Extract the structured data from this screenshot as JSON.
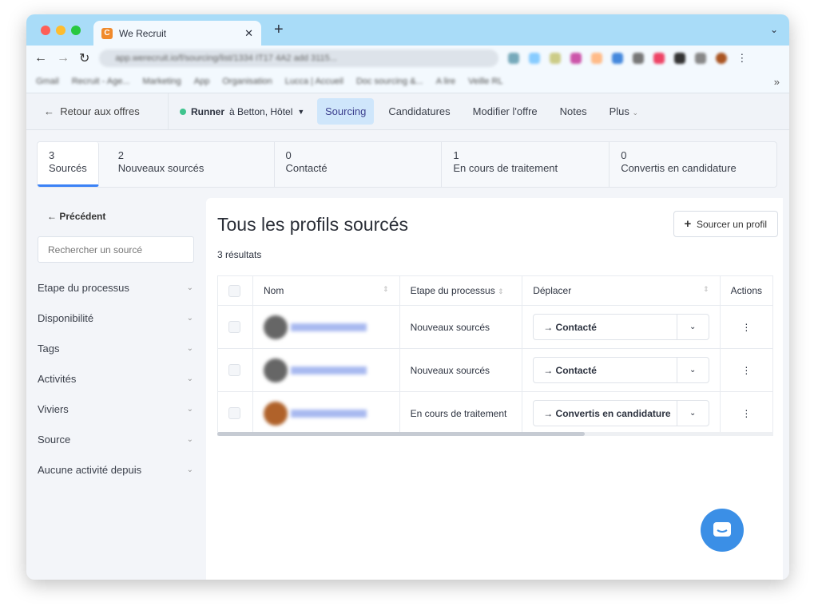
{
  "browser": {
    "tab_title": "We Recruit",
    "url": "app.werecruit.io/f/sourcing/list/1334 IT17 4A2 add 3115...",
    "bookmarks": [
      "Gmail",
      "Recruit - Age...",
      "Marketing",
      "App",
      "Organisation",
      "Lucca | Accueil",
      "Doc sourcing &...",
      "A lire",
      "Veille RL"
    ]
  },
  "appnav": {
    "back": "Retour aux offres",
    "job_title": "Runner",
    "job_location": "à Betton, Hôtel",
    "tabs": [
      {
        "label": "Sourcing",
        "active": true
      },
      {
        "label": "Candidatures"
      },
      {
        "label": "Modifier l'offre"
      },
      {
        "label": "Notes"
      },
      {
        "label": "Plus"
      }
    ]
  },
  "stages": [
    {
      "count": "3",
      "label": "Sourcés"
    },
    {
      "count": "2",
      "label": "Nouveaux sourcés"
    },
    {
      "count": "0",
      "label": "Contacté"
    },
    {
      "count": "1",
      "label": "En cours de traitement"
    },
    {
      "count": "0",
      "label": "Convertis en candidature"
    }
  ],
  "sidebar": {
    "previous": "Précédent",
    "search_placeholder": "Rechercher un sourcé",
    "filters": [
      "Etape du processus",
      "Disponibilité",
      "Tags",
      "Activités",
      "Viviers",
      "Source",
      "Aucune activité depuis"
    ]
  },
  "main": {
    "title": "Tous les profils sourcés",
    "add_button": "Sourcer un profil",
    "results": "3 résultats",
    "columns": [
      "Nom",
      "Etape du processus",
      "Déplacer",
      "Actions"
    ],
    "rows": [
      {
        "stage": "Nouveaux sourcés",
        "move": "→ Contacté",
        "avatar_color": "#666666"
      },
      {
        "stage": "Nouveaux sourcés",
        "move": "→ Contacté",
        "avatar_color": "#666666"
      },
      {
        "stage": "En cours de traitement",
        "move": "→ Convertis en candidature",
        "avatar_color": "#b0622a"
      }
    ]
  },
  "colors": {
    "accent": "#3b82f6",
    "active_tab_bg": "#cfe6fb",
    "chat": "#3b8fe6"
  }
}
